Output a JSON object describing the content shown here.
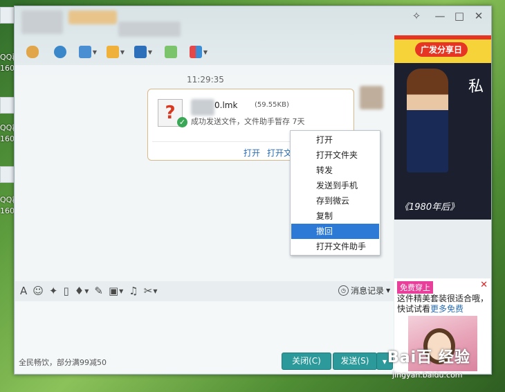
{
  "desktop": {
    "labels": [
      "QQ群",
      "160",
      "QQ群",
      "160",
      "QQ群",
      "160",
      "QQ群",
      "160"
    ]
  },
  "window": {
    "controls": {
      "close": "✕",
      "maximize": "□",
      "minimize": "—",
      "skin": "✧"
    }
  },
  "chat": {
    "timestamp": "11:29:35",
    "file_message": {
      "file_name_visible": "0.lmk",
      "file_size": "(59.55KB)",
      "status": "成功发送文件，文件助手暂存 7天",
      "open_link": "打开",
      "open_folder_link": "打开文"
    }
  },
  "context_menu": {
    "items": [
      {
        "label": "打开"
      },
      {
        "label": "打开文件夹"
      },
      {
        "label": "转发"
      },
      {
        "label": "发送到手机"
      },
      {
        "label": "存到微云"
      },
      {
        "label": "复制"
      },
      {
        "label": "撤回"
      },
      {
        "label": "打开文件助手"
      }
    ],
    "selected_index": 6
  },
  "input": {
    "history_label": "消息记录",
    "status_text": "全民畅饮，部分满99减50",
    "close_button": "关闭(C)",
    "send_button": "发送(S)"
  },
  "ads": {
    "right_top": {
      "pill": "广发分享日",
      "corner_big": "私",
      "footer": "《1980年后》"
    },
    "right_bottom": {
      "tag": "免费穿上",
      "text": "这件精美套装很适合哦，快试试看",
      "more": "更多免费",
      "close": "✕"
    }
  },
  "watermark": {
    "brand": "Bai百 经验",
    "url": "jingyan.baidu.com"
  }
}
